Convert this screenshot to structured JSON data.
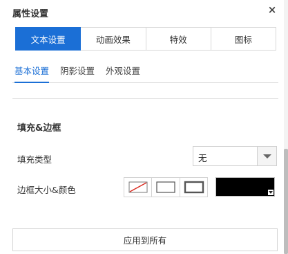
{
  "panel": {
    "title": "属性设置",
    "close_glyph": "×"
  },
  "tabs": [
    {
      "label": "文本设置",
      "active": true
    },
    {
      "label": "动画效果",
      "active": false
    },
    {
      "label": "特效",
      "active": false
    },
    {
      "label": "图标",
      "active": false
    }
  ],
  "subtabs": [
    {
      "label": "基本设置",
      "active": true
    },
    {
      "label": "阴影设置",
      "active": false
    },
    {
      "label": "外观设置",
      "active": false
    }
  ],
  "section": {
    "title": "填充&边框",
    "fill_type_label": "填充类型",
    "fill_type_value": "无",
    "border_label": "边框大小&颜色",
    "border_color": "#000000"
  },
  "apply_label": "应用到所有",
  "colors": {
    "accent": "#1b6fd6"
  },
  "icons": [
    "close-icon",
    "chevron-down-icon",
    "no-border-icon",
    "thin-border-icon",
    "thick-border-icon"
  ]
}
